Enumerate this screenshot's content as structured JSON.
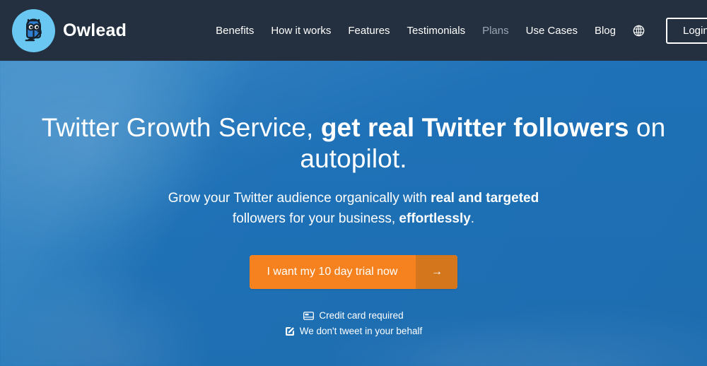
{
  "header": {
    "brand": {
      "name": "Owlead",
      "logo_icon": "owl-logo-icon",
      "logo_bg_color": "#69c7f2"
    },
    "nav_items": [
      {
        "label": "Benefits",
        "muted": false
      },
      {
        "label": "How it works",
        "muted": false
      },
      {
        "label": "Features",
        "muted": false
      },
      {
        "label": "Testimonials",
        "muted": false
      },
      {
        "label": "Plans",
        "muted": true
      },
      {
        "label": "Use Cases",
        "muted": false
      },
      {
        "label": "Blog",
        "muted": false
      }
    ],
    "language_icon": "globe-icon",
    "login_label": "Login",
    "background_color": "#24303f"
  },
  "hero": {
    "title": {
      "part1": "Twitter Growth Service, ",
      "bold1": "get real Twitter followers",
      "part2": " on autopilot."
    },
    "title_plain": "Twitter Growth Service, get real Twitter followers on autopilot.",
    "subtitle": {
      "part1": "Grow your Twitter audience organically with ",
      "bold1": "real and targeted",
      "part2": " followers for your business, ",
      "bold2": "effortlessly",
      "part3": "."
    },
    "subtitle_plain": "Grow your Twitter audience organically with real and targeted followers for your business, effortlessly.",
    "cta": {
      "label": "I want my 10 day trial now",
      "arrow_glyph": "→",
      "color": "#f5821f",
      "arrow_color": "#d4761c"
    },
    "notes": [
      {
        "icon": "credit-card-icon",
        "text": "Credit card required"
      },
      {
        "icon": "pencil-edit-icon",
        "text": "We don't tweet in your behalf"
      }
    ],
    "background_color": "#2176bd"
  }
}
